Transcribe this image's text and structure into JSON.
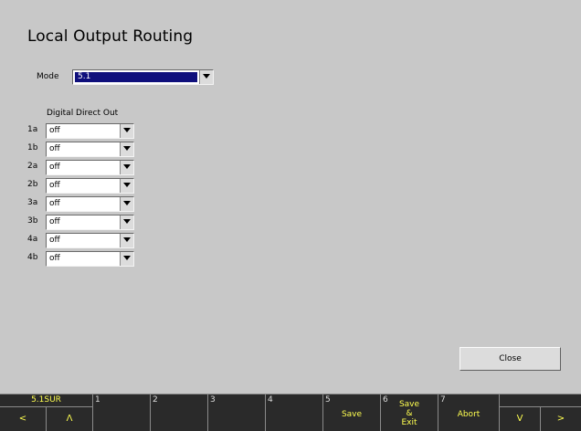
{
  "title": "Local Output Routing",
  "mode": {
    "label": "Mode",
    "value": "5.1"
  },
  "group_label": "Digital Direct Out",
  "outputs": [
    {
      "label": "1a",
      "value": "off"
    },
    {
      "label": "1b",
      "value": "off"
    },
    {
      "label": "2a",
      "value": "off"
    },
    {
      "label": "2b",
      "value": "off"
    },
    {
      "label": "3a",
      "value": "off"
    },
    {
      "label": "3b",
      "value": "off"
    },
    {
      "label": "4a",
      "value": "off"
    },
    {
      "label": "4b",
      "value": "off"
    }
  ],
  "close_label": "Close",
  "softkeys": {
    "preset_label": "5.1SUR",
    "left_arrow": "<",
    "up_arrow": "Λ",
    "keys": [
      {
        "num": "1",
        "label": ""
      },
      {
        "num": "2",
        "label": ""
      },
      {
        "num": "3",
        "label": ""
      },
      {
        "num": "4",
        "label": ""
      },
      {
        "num": "5",
        "label": "Save"
      },
      {
        "num": "6",
        "label": "Save\n&\nExit"
      },
      {
        "num": "7",
        "label": "Abort"
      }
    ],
    "down_arrow": "V",
    "right_arrow": ">"
  },
  "colors": {
    "background": "#c8c8c8",
    "softbar": "#2a2a2a",
    "softkey_text": "#ffff50",
    "selection": "#10107c"
  }
}
